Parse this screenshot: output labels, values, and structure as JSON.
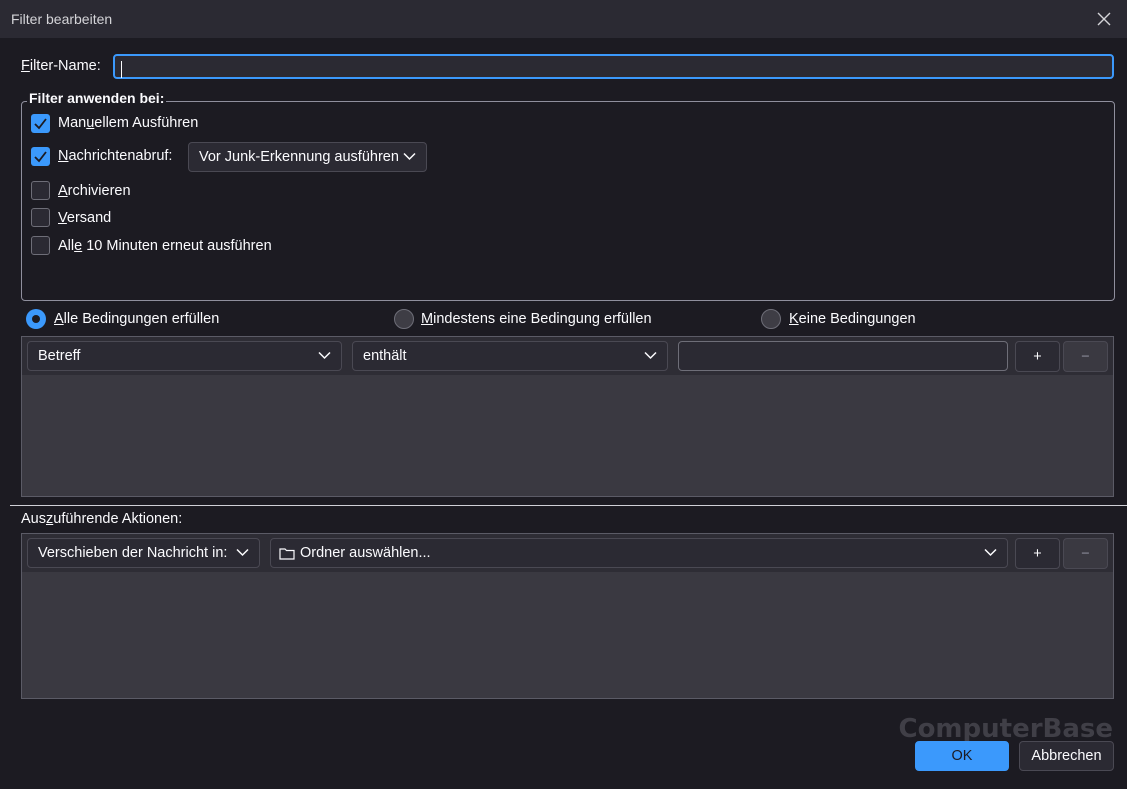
{
  "window": {
    "title": "Filter bearbeiten"
  },
  "filter_name": {
    "label_pre": "F",
    "label_rest": "ilter-Name:",
    "value": ""
  },
  "apply_group": {
    "legend": "Filter anwenden bei:",
    "manual": {
      "checked": true,
      "pre": "Man",
      "u": "u",
      "post": "ellem Ausführen"
    },
    "fetch": {
      "checked": true,
      "pre": "",
      "u": "N",
      "post": "achrichtenabruf:",
      "option": "Vor Junk-Erkennung ausführen"
    },
    "archive": {
      "checked": false,
      "pre": "",
      "u": "A",
      "post": "rchivieren"
    },
    "send": {
      "checked": false,
      "pre": "",
      "u": "V",
      "post": "ersand"
    },
    "periodic": {
      "checked": false,
      "pre": "All",
      "u": "e",
      "post": " 10 Minuten erneut ausführen"
    }
  },
  "match": {
    "all": {
      "u": "A",
      "post": "lle Bedingungen erfüllen",
      "selected": true
    },
    "any": {
      "u": "M",
      "post": "indestens eine Bedingung erfüllen",
      "selected": false
    },
    "none": {
      "u": "K",
      "post": "eine Bedingungen",
      "selected": false
    }
  },
  "condition": {
    "field": "Betreff",
    "operator": "enthält",
    "value": "",
    "add": "+",
    "remove": "−"
  },
  "actions": {
    "label_pre": "Aus",
    "label_u": "z",
    "label_post": "uführende Aktionen:",
    "action": "Verschieben der Nachricht in:",
    "folder": "Ordner auswählen...",
    "add": "+",
    "remove": "−"
  },
  "footer": {
    "ok": "OK",
    "cancel": "Abbrechen"
  },
  "watermark": "ComputerBase",
  "colors": {
    "accent": "#3b99fc",
    "background": "#1c1b22",
    "panel": "#3a3941"
  }
}
